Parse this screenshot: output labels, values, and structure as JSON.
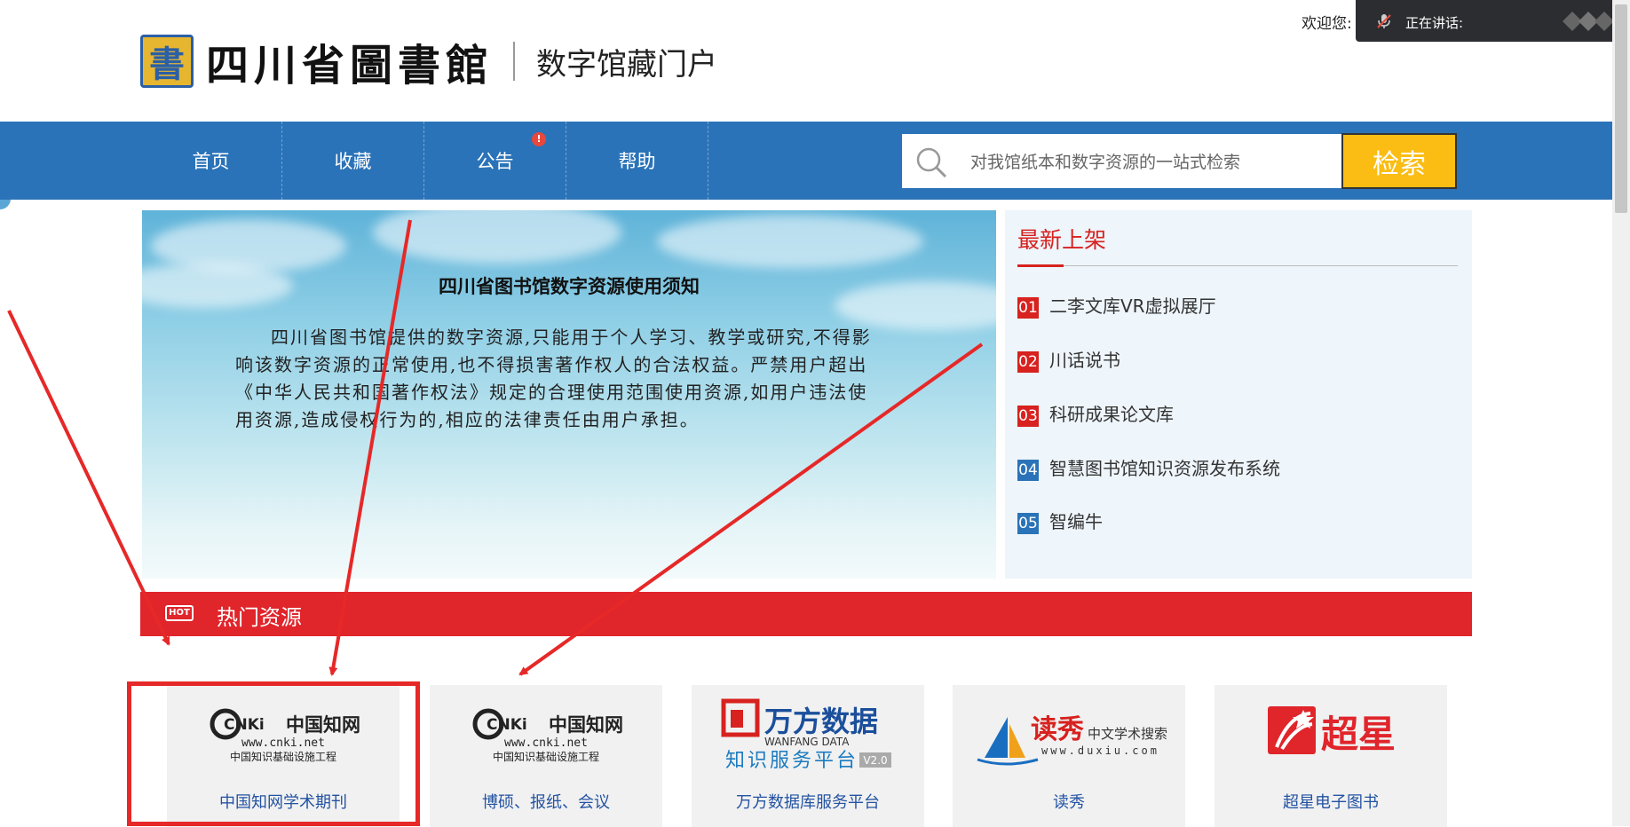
{
  "header": {
    "logo_char": "書",
    "logo_text": "四川省圖書館",
    "portal_name": "数字馆藏门户",
    "welcome": "欢迎您:",
    "meeting_status": "正在讲话:"
  },
  "nav": {
    "items": [
      {
        "label": "首页"
      },
      {
        "label": "收藏"
      },
      {
        "label": "公告"
      },
      {
        "label": "帮助"
      }
    ],
    "badge": "!"
  },
  "search": {
    "placeholder": "对我馆纸本和数字资源的一站式检索",
    "button": "检索"
  },
  "banner": {
    "title": "四川省图书馆数字资源使用须知",
    "body": "四川省图书馆提供的数字资源,只能用于个人学习、教学或研究,不得影响该数字资源的正常使用,也不得损害著作权人的合法权益。严禁用户超出《中华人民共和国著作权法》规定的合理使用范围使用资源,如用户违法使用资源,造成侵权行为的,相应的法律责任由用户承担。"
  },
  "new_arrivals": {
    "title": "最新上架",
    "items": [
      {
        "num": "01",
        "label": "二李文库VR虚拟展厅",
        "color": "#d7221f"
      },
      {
        "num": "02",
        "label": "川话说书",
        "color": "#d7221f"
      },
      {
        "num": "03",
        "label": "科研成果论文库",
        "color": "#d7221f"
      },
      {
        "num": "04",
        "label": "智慧图书馆知识资源发布系统",
        "color": "#2b73b8"
      },
      {
        "num": "05",
        "label": "智编牛",
        "color": "#2b73b8"
      }
    ]
  },
  "hot": {
    "icon": "HOT",
    "title": "热门资源"
  },
  "resources": [
    {
      "label": "中国知网学术期刊",
      "logo": {
        "brand": "CNKi",
        "cn": "中国知网",
        "url": "www.cnki.net",
        "sub": "中国知识基础设施工程"
      }
    },
    {
      "label": "博硕、报纸、会议",
      "logo": {
        "brand": "CNKi",
        "cn": "中国知网",
        "url": "www.cnki.net",
        "sub": "中国知识基础设施工程"
      }
    },
    {
      "label": "万方数据库服务平台",
      "logo": {
        "brand": "万方数据",
        "en": "WANFANG DATA",
        "sub": "知识服务平台",
        "ver": "V2.0"
      }
    },
    {
      "label": "读秀",
      "logo": {
        "brand": "读秀",
        "sub": "中文学术搜索",
        "url": "www.duxiu.com"
      }
    },
    {
      "label": "超星电子图书",
      "logo": {
        "brand": "超星"
      }
    }
  ],
  "colors": {
    "nav_blue": "#2b73b8",
    "search_yellow": "#fbbd13",
    "hot_red": "#e0252b",
    "annotation_red": "#e62828"
  }
}
